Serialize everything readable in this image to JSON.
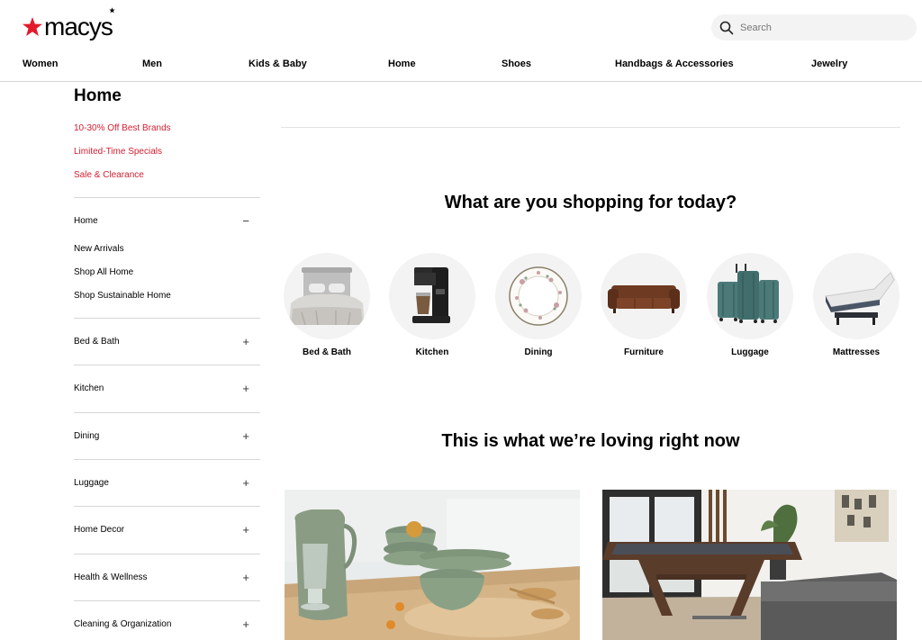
{
  "header": {
    "logo_text": "macys",
    "search_placeholder": "Search",
    "nav": [
      "Women",
      "Men",
      "Kids & Baby",
      "Home",
      "Shoes",
      "Handbags & Accessories",
      "Jewelry"
    ]
  },
  "sidebar": {
    "title": "Home",
    "promos": [
      "10-30% Off Best Brands",
      "Limited-Time Specials",
      "Sale & Clearance"
    ],
    "expanded": {
      "label": "Home",
      "toggle": "−",
      "links": [
        "New Arrivals",
        "Shop All Home",
        "Shop Sustainable Home"
      ]
    },
    "categories": [
      {
        "label": "Bed & Bath",
        "toggle": "+"
      },
      {
        "label": "Kitchen",
        "toggle": "+"
      },
      {
        "label": "Dining",
        "toggle": "+"
      },
      {
        "label": "Luggage",
        "toggle": "+"
      },
      {
        "label": "Home Decor",
        "toggle": "+"
      },
      {
        "label": "Health & Wellness",
        "toggle": "+"
      },
      {
        "label": "Cleaning & Organization",
        "toggle": "+"
      }
    ]
  },
  "main": {
    "shopping_heading": "What are you shopping for today?",
    "shop_categories": [
      {
        "label": "Bed & Bath",
        "icon": "bed-icon"
      },
      {
        "label": "Kitchen",
        "icon": "coffee-maker-icon"
      },
      {
        "label": "Dining",
        "icon": "plate-icon"
      },
      {
        "label": "Furniture",
        "icon": "sofa-icon"
      },
      {
        "label": "Luggage",
        "icon": "luggage-icon"
      },
      {
        "label": "Mattresses",
        "icon": "mattress-icon"
      }
    ],
    "loving_heading": "This is what we’re loving right now"
  },
  "colors": {
    "brand_red": "#e21a2c",
    "promo_red": "#d12031",
    "divider": "#d6d6d6",
    "circle_bg": "#f3f3f3"
  }
}
